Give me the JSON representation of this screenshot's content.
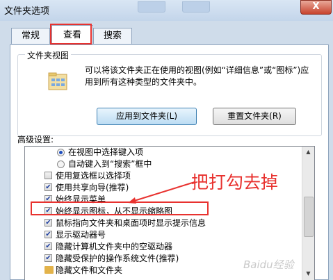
{
  "window": {
    "title": "文件夹选项",
    "close_label": "X"
  },
  "tabs": [
    {
      "label": "常规",
      "active": false
    },
    {
      "label": "查看",
      "active": true
    },
    {
      "label": "搜索",
      "active": false
    }
  ],
  "folder_views": {
    "legend": "文件夹视图",
    "description": "可以将该文件夹正在使用的视图(例如“详细信息”或“图标”)应用到所有这种类型的文件夹中。",
    "apply_button": "应用到文件夹(L)",
    "reset_button": "重置文件夹(R)"
  },
  "advanced": {
    "label": "高级设置:",
    "items": [
      {
        "type": "radio",
        "checked": true,
        "text": "在视图中选择键入项"
      },
      {
        "type": "radio",
        "checked": false,
        "text": "自动键入到“搜索”框中"
      },
      {
        "type": "checkbox",
        "checked": false,
        "text": "使用复选框以选择项"
      },
      {
        "type": "checkbox",
        "checked": true,
        "text": "使用共享向导(推荐)"
      },
      {
        "type": "checkbox",
        "checked": true,
        "text": "始终显示菜单"
      },
      {
        "type": "checkbox",
        "checked": true,
        "text": "始终显示图标，从不显示缩略图"
      },
      {
        "type": "checkbox",
        "checked": true,
        "text": "鼠标指向文件夹和桌面项时显示提示信息"
      },
      {
        "type": "checkbox",
        "checked": true,
        "text": "显示驱动器号"
      },
      {
        "type": "checkbox",
        "checked": true,
        "text": "隐藏计算机文件夹中的空驱动器"
      },
      {
        "type": "checkbox",
        "checked": true,
        "text": "隐藏受保护的操作系统文件(推荐)"
      },
      {
        "type": "folder",
        "checked": false,
        "text": "隐藏文件和文件夹"
      }
    ]
  },
  "annotation": {
    "text": "把打勾去掉"
  },
  "watermark": {
    "text": "Baidu经验"
  },
  "colors": {
    "highlight": "#e8322f",
    "accent": "#1f4fbf"
  },
  "icons": {
    "close": "close-icon",
    "folder": "folder-view-icon",
    "scroll_up": "scroll-up-icon",
    "scroll_down": "scroll-down-icon"
  }
}
